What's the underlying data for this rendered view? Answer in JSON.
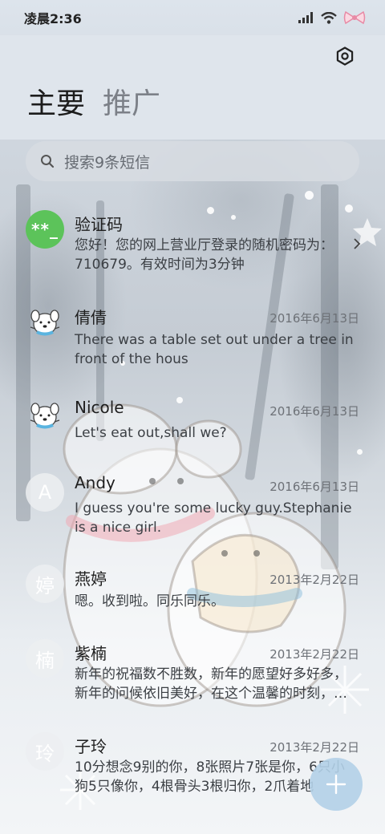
{
  "status_bar": {
    "time": "凌晨2:36",
    "icons": [
      "signal-icon",
      "wifi-icon",
      "bow-icon"
    ]
  },
  "header": {
    "settings_icon": "settings-icon",
    "tabs": [
      {
        "label": "主要",
        "active": true
      },
      {
        "label": "推广",
        "active": false
      }
    ]
  },
  "search": {
    "placeholder": "搜索9条短信",
    "icon": "search-icon"
  },
  "conversations": [
    {
      "name": "验证码",
      "avatar": "**_",
      "date": "",
      "preview": "您好！您的网上营业厅登录的随机密码为：710679。有效时间为3分钟"
    },
    {
      "name": "倩倩",
      "avatar": "dog",
      "date": "2016年6月13日",
      "preview": "There was a table set out under a tree in front of the hous"
    },
    {
      "name": "Nicole",
      "avatar": "dog",
      "date": "2016年6月13日",
      "preview": "Let's eat out,shall we?"
    },
    {
      "name": "Andy",
      "avatar": "A",
      "date": "2016年6月13日",
      "preview": "I guess you're some lucky guy.Stephanie is a nice girl."
    },
    {
      "name": "燕婷",
      "avatar": "婷",
      "date": "2013年2月22日",
      "preview": "嗯。收到啦。同乐同乐。"
    },
    {
      "name": "紫楠",
      "avatar": "楠",
      "date": "2013年2月22日",
      "preview": "新年的祝福数不胜数，新年的愿望好多好多，新年的问候依旧美好，在这个温馨的时刻，…"
    },
    {
      "name": "子玲",
      "avatar": "玲",
      "date": "2013年2月22日",
      "preview": "10分想念9别的你，8张照片7张是你，6只小狗5只像你，4根骨头3根归你，2爪着地"
    }
  ],
  "fab": {
    "icon": "plus-icon"
  },
  "colors": {
    "verification_avatar": "#5cc35a",
    "fab": "#b2d0e8"
  }
}
